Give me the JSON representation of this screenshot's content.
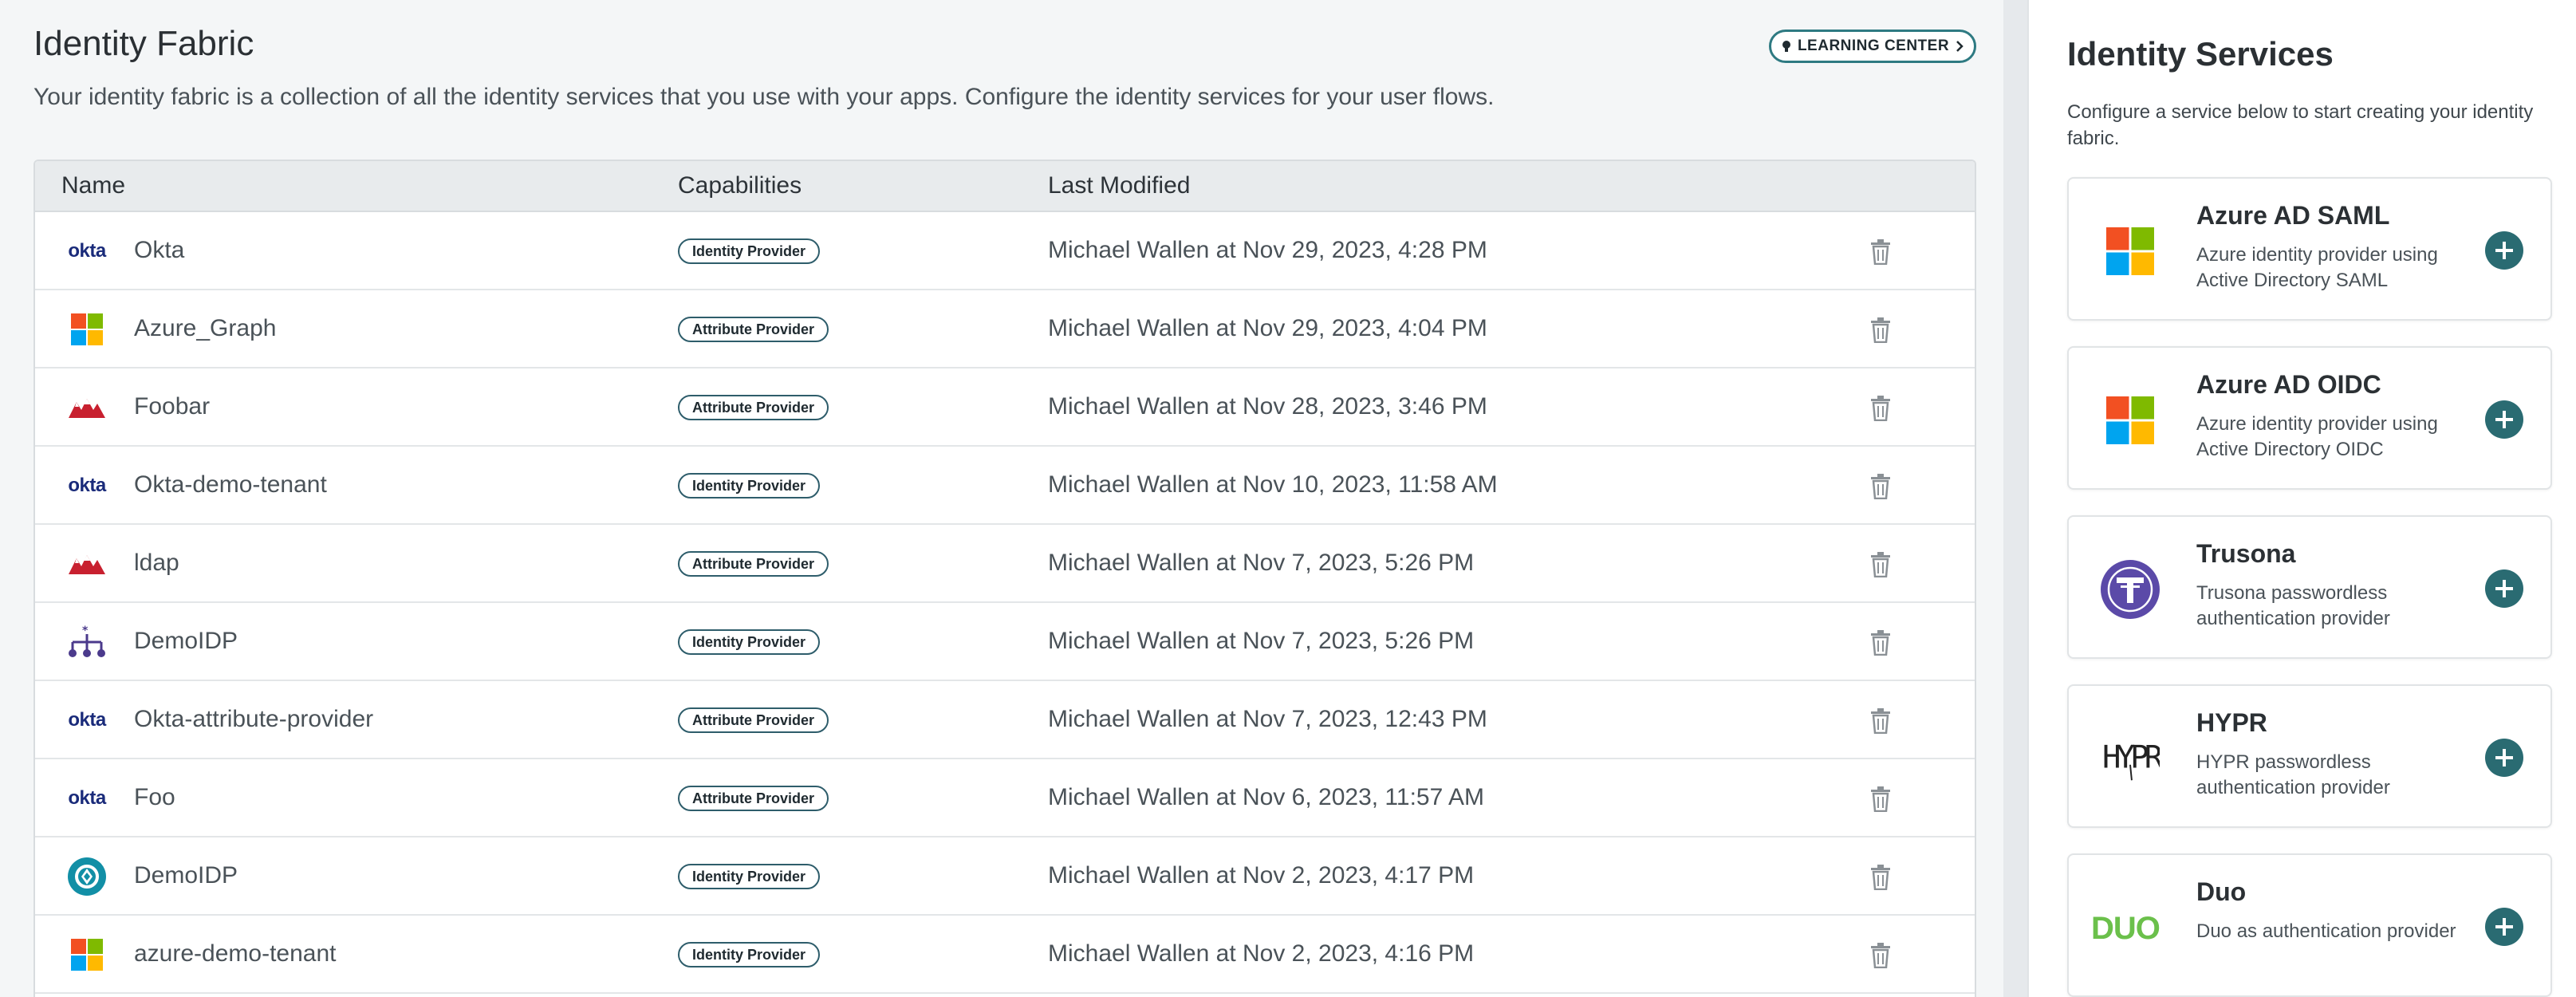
{
  "header": {
    "title": "Identity Fabric",
    "description": "Your identity fabric is a collection of all the identity services that you use with your apps. Configure the identity services for your user flows.",
    "learning_center_label": "LEARNING CENTER"
  },
  "table": {
    "columns": {
      "name": "Name",
      "capabilities": "Capabilities",
      "last_modified": "Last Modified"
    },
    "rows": [
      {
        "logo": "okta-logo",
        "logo_text": "okta",
        "name": "Okta",
        "capability": "Identity Provider",
        "modified": "Michael Wallen at Nov 29, 2023, 4:28 PM"
      },
      {
        "logo": "microsoft-logo",
        "name": "Azure_Graph",
        "capability": "Attribute Provider",
        "modified": "Michael Wallen at Nov 29, 2023, 4:04 PM"
      },
      {
        "logo": "mountain-logo",
        "name": "Foobar",
        "capability": "Attribute Provider",
        "modified": "Michael Wallen at Nov 28, 2023, 3:46 PM"
      },
      {
        "logo": "okta-logo",
        "logo_text": "okta",
        "name": "Okta-demo-tenant",
        "capability": "Identity Provider",
        "modified": "Michael Wallen at Nov 10, 2023, 11:58 AM"
      },
      {
        "logo": "mountain-logo",
        "name": "ldap",
        "capability": "Attribute Provider",
        "modified": "Michael Wallen at Nov 7, 2023, 5:26 PM"
      },
      {
        "logo": "network-logo",
        "name": "DemoIDP",
        "capability": "Identity Provider",
        "modified": "Michael Wallen at Nov 7, 2023, 5:26 PM"
      },
      {
        "logo": "okta-logo",
        "logo_text": "okta",
        "name": "Okta-attribute-provider",
        "capability": "Attribute Provider",
        "modified": "Michael Wallen at Nov 7, 2023, 12:43 PM"
      },
      {
        "logo": "okta-logo",
        "logo_text": "okta",
        "name": "Foo",
        "capability": "Attribute Provider",
        "modified": "Michael Wallen at Nov 6, 2023, 11:57 AM"
      },
      {
        "logo": "teal-circle-logo",
        "name": "DemoIDP",
        "capability": "Identity Provider",
        "modified": "Michael Wallen at Nov 2, 2023, 4:17 PM"
      },
      {
        "logo": "microsoft-logo",
        "name": "azure-demo-tenant",
        "capability": "Identity Provider",
        "modified": "Michael Wallen at Nov 2, 2023, 4:16 PM"
      }
    ]
  },
  "services_panel": {
    "title": "Identity Services",
    "description": "Configure a service below to start creating your identity fabric.",
    "services": [
      {
        "logo": "microsoft-logo",
        "name": "Azure AD SAML",
        "description": "Azure identity provider using Active Directory SAML"
      },
      {
        "logo": "microsoft-logo",
        "name": "Azure AD OIDC",
        "description": "Azure identity provider using Active Directory OIDC"
      },
      {
        "logo": "trusona-logo",
        "name": "Trusona",
        "description": "Trusona passwordless authentication provider"
      },
      {
        "logo": "hypr-logo",
        "logo_text": "HYPR",
        "name": "HYPR",
        "description": "HYPR passwordless authentication provider"
      },
      {
        "logo": "duo-logo",
        "logo_text": "DUO",
        "name": "Duo",
        "description": "Duo as authentication provider"
      }
    ]
  },
  "colors": {
    "accent": "#2a6b72",
    "badge_border": "#2e5d6b",
    "okta_blue": "#1a2b7a",
    "mountain_red": "#c8202f",
    "network_purple": "#4b3a8c",
    "duo_green": "#6bc04b",
    "trusona_purple": "#5b4aa8"
  }
}
